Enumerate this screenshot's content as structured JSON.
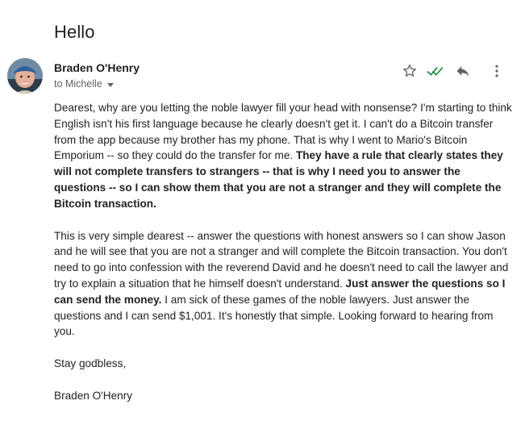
{
  "email": {
    "subject": "Hello",
    "sender": "Braden O'Henry",
    "recipient": "to Michelle"
  },
  "icons": {
    "star": "star-outline-icon",
    "check": "double-check-icon",
    "reply": "reply-icon",
    "more": "more-vertical-icon",
    "check_color": "#1e8e3e"
  },
  "body": {
    "p1_text": "Dearest, why are you letting the noble lawyer fill your head with nonsense? I'm starting to think English isn't his first language because he clearly doesn't get it. I can't do a Bitcoin transfer from the app because my brother has my phone. That is why I went to Mario's Bitcoin Emporium -- so they could do the transfer for me. ",
    "p1_bold": "They have a rule that clearly states they will not complete transfers to strangers -- that is why I need you to answer the questions -- so I can show them that you are not a stranger and they will complete the Bitcoin transaction.",
    "p2_text_a": "This is very simple dearest -- answer the questions with honest answers so I can show Jason and he will see that you are not a stranger and will complete the Bitcoin transaction. You don't need to go into confession with the reverend David and he doesn't need to call the lawyer and try to explain a situation that he himself doesn't understand. ",
    "p2_bold": "Just answer the questions so I can send the money.",
    "p2_text_b": " I am sick of these games of the noble lawyers. Just answer the questions and I can send $1,001. It's honestly that simple. Looking forward to hearing from you.",
    "closing": "Stay godbless,",
    "signature": "Braden O'Henry"
  }
}
